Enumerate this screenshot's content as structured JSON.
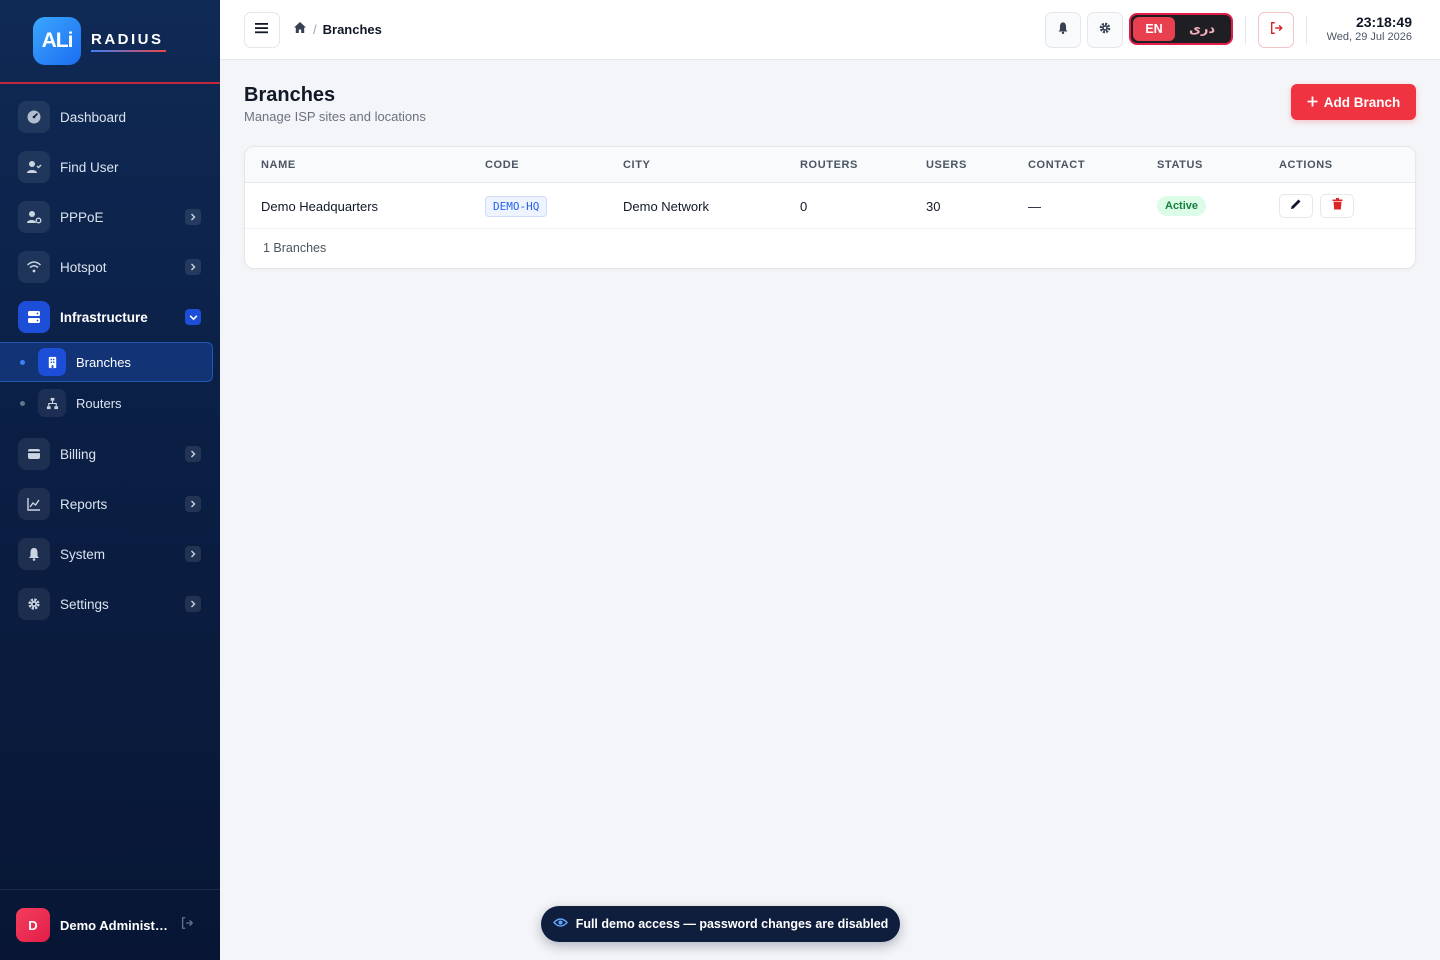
{
  "brand": {
    "logo_text": "ALi",
    "name": "RADIUS"
  },
  "sidebar": {
    "items": [
      {
        "label": "Dashboard"
      },
      {
        "label": "Find User"
      },
      {
        "label": "PPPoE"
      },
      {
        "label": "Hotspot"
      },
      {
        "label": "Infrastructure"
      },
      {
        "label": "Billing"
      },
      {
        "label": "Reports"
      },
      {
        "label": "System"
      },
      {
        "label": "Settings"
      }
    ],
    "sub_items": [
      {
        "label": "Branches"
      },
      {
        "label": "Routers"
      }
    ],
    "user": {
      "initial": "D",
      "name": "Demo Administrator"
    }
  },
  "topbar": {
    "breadcrumb_current": "Branches",
    "lang_en": "EN",
    "lang_fa": "دری",
    "time": "23:18:49",
    "date": "Wed, 29 Jul 2026"
  },
  "page": {
    "title": "Branches",
    "subtitle": "Manage ISP sites and locations",
    "add_button": "Add Branch"
  },
  "table": {
    "columns": [
      "NAME",
      "CODE",
      "CITY",
      "ROUTERS",
      "USERS",
      "CONTACT",
      "STATUS",
      "ACTIONS"
    ],
    "rows": [
      {
        "name": "Demo Headquarters",
        "code": "DEMO-HQ",
        "city": "Demo Network",
        "routers": "0",
        "users": "30",
        "contact": "—",
        "status": "Active"
      }
    ],
    "footer": "1 Branches"
  },
  "toast": {
    "text": "Full demo access — password changes are disabled"
  },
  "colors": {
    "accent": "#ef3340",
    "sidebar_bg": "#0b1f45",
    "active": "#1d4ed8",
    "success": "#15803d"
  }
}
